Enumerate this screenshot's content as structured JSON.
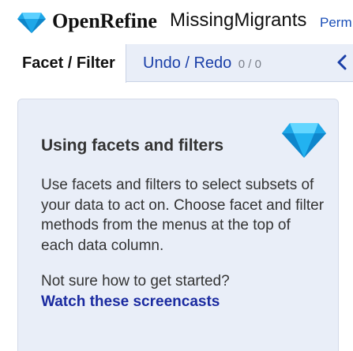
{
  "header": {
    "app_name": "OpenRefine",
    "project_name": "MissingMigrants",
    "permalink_label": "Perm",
    "logo_icon": "diamond-gem-icon",
    "accent": "#1a4fb8"
  },
  "tabs": {
    "facet_filter": "Facet / Filter",
    "undo_redo": "Undo / Redo",
    "undo_redo_count": "0 / 0",
    "collapse_icon": "chevron-left-icon"
  },
  "help": {
    "title": "Using facets and filters",
    "body": "Use facets and filters to select subsets of your data to act on. Choose facet and filter methods from the menus at the top of each data column.",
    "question": "Not sure how to get started?",
    "link": "Watch these screencasts",
    "icon": "diamond-gem-icon"
  }
}
